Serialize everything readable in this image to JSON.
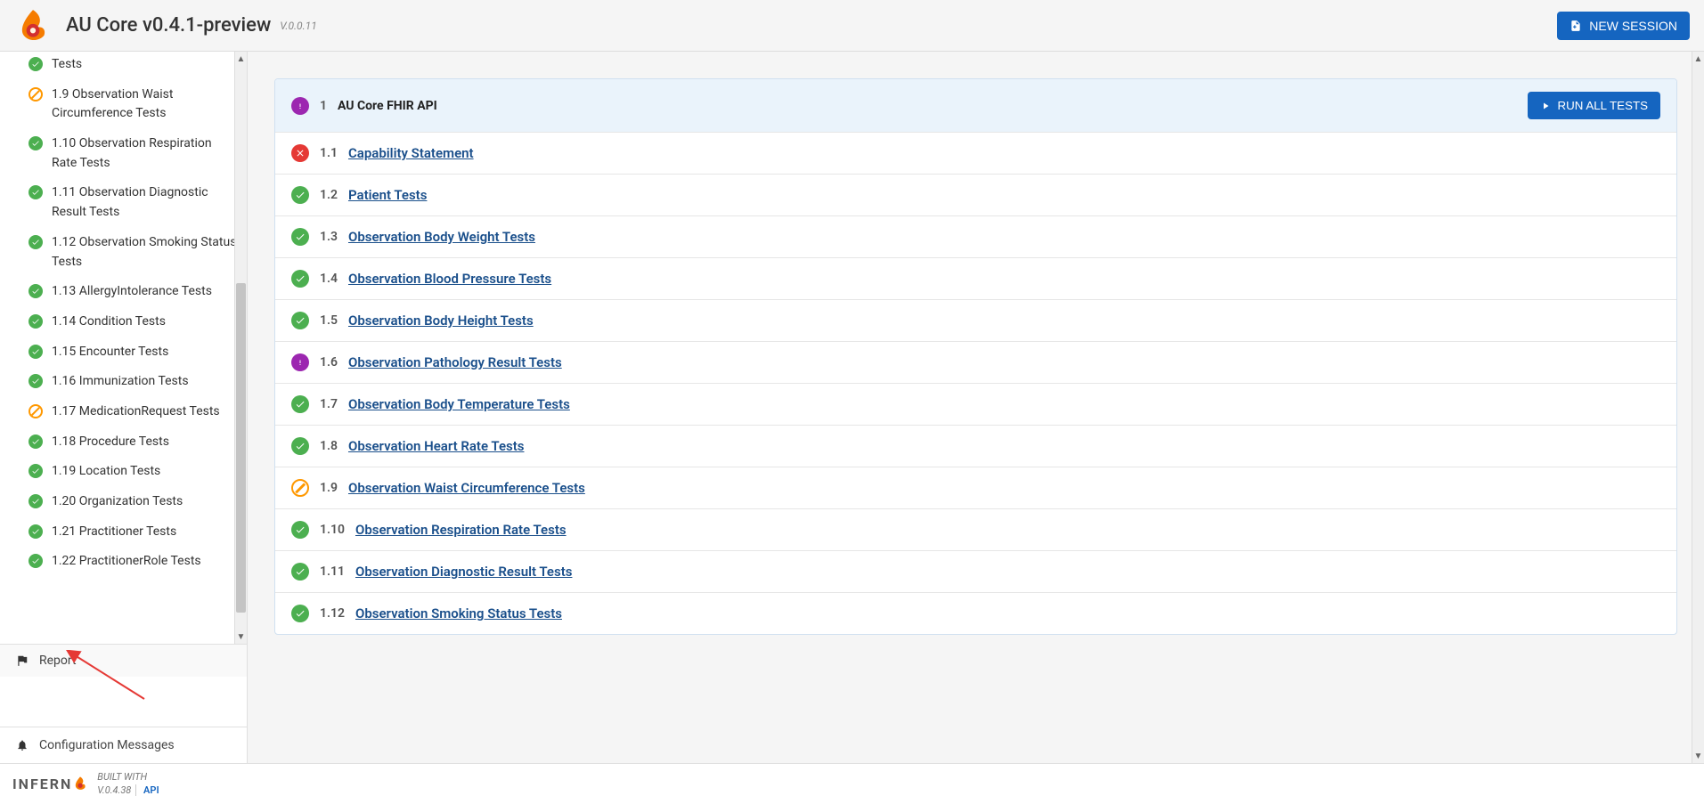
{
  "header": {
    "title": "AU Core v0.4.1-preview",
    "subver": "V.0.0.11",
    "new_session": "NEW SESSION"
  },
  "sidebar": {
    "items": [
      {
        "id": "1.8",
        "label": "Tests",
        "status": "pass",
        "partial": true
      },
      {
        "id": "1.9",
        "label": "1.9 Observation Waist Circumference Tests",
        "status": "skip"
      },
      {
        "id": "1.10",
        "label": "1.10 Observation Respiration Rate Tests",
        "status": "pass"
      },
      {
        "id": "1.11",
        "label": "1.11 Observation Diagnostic Result Tests",
        "status": "pass"
      },
      {
        "id": "1.12",
        "label": "1.12 Observation Smoking Status Tests",
        "status": "pass"
      },
      {
        "id": "1.13",
        "label": "1.13 AllergyIntolerance Tests",
        "status": "pass"
      },
      {
        "id": "1.14",
        "label": "1.14 Condition Tests",
        "status": "pass"
      },
      {
        "id": "1.15",
        "label": "1.15 Encounter Tests",
        "status": "pass"
      },
      {
        "id": "1.16",
        "label": "1.16 Immunization Tests",
        "status": "pass"
      },
      {
        "id": "1.17",
        "label": "1.17 MedicationRequest Tests",
        "status": "skip"
      },
      {
        "id": "1.18",
        "label": "1.18 Procedure Tests",
        "status": "pass"
      },
      {
        "id": "1.19",
        "label": "1.19 Location Tests",
        "status": "pass"
      },
      {
        "id": "1.20",
        "label": "1.20 Organization Tests",
        "status": "pass"
      },
      {
        "id": "1.21",
        "label": "1.21 Practitioner Tests",
        "status": "pass"
      },
      {
        "id": "1.22",
        "label": "1.22 PractitionerRole Tests",
        "status": "pass"
      }
    ],
    "report": "Report",
    "config": "Configuration Messages"
  },
  "main": {
    "group": {
      "idx": "1",
      "name": "AU Core FHIR API",
      "status": "warn"
    },
    "run_all": "RUN ALL TESTS",
    "rows": [
      {
        "idx": "1.1",
        "name": "Capability Statement",
        "status": "fail"
      },
      {
        "idx": "1.2",
        "name": "Patient Tests",
        "status": "pass"
      },
      {
        "idx": "1.3",
        "name": "Observation Body Weight Tests",
        "status": "pass"
      },
      {
        "idx": "1.4",
        "name": "Observation Blood Pressure Tests",
        "status": "pass"
      },
      {
        "idx": "1.5",
        "name": "Observation Body Height Tests",
        "status": "pass"
      },
      {
        "idx": "1.6",
        "name": "Observation Pathology Result Tests",
        "status": "warn"
      },
      {
        "idx": "1.7",
        "name": "Observation Body Temperature Tests",
        "status": "pass"
      },
      {
        "idx": "1.8",
        "name": "Observation Heart Rate Tests",
        "status": "pass"
      },
      {
        "idx": "1.9",
        "name": "Observation Waist Circumference Tests",
        "status": "skip"
      },
      {
        "idx": "1.10",
        "name": "Observation Respiration Rate Tests",
        "status": "pass"
      },
      {
        "idx": "1.11",
        "name": "Observation Diagnostic Result Tests",
        "status": "pass"
      },
      {
        "idx": "1.12",
        "name": "Observation Smoking Status Tests",
        "status": "pass"
      }
    ]
  },
  "footer": {
    "brand": "INFERN",
    "built_with": "BUILT WITH",
    "version": "V.0.4.38",
    "api": "API"
  }
}
